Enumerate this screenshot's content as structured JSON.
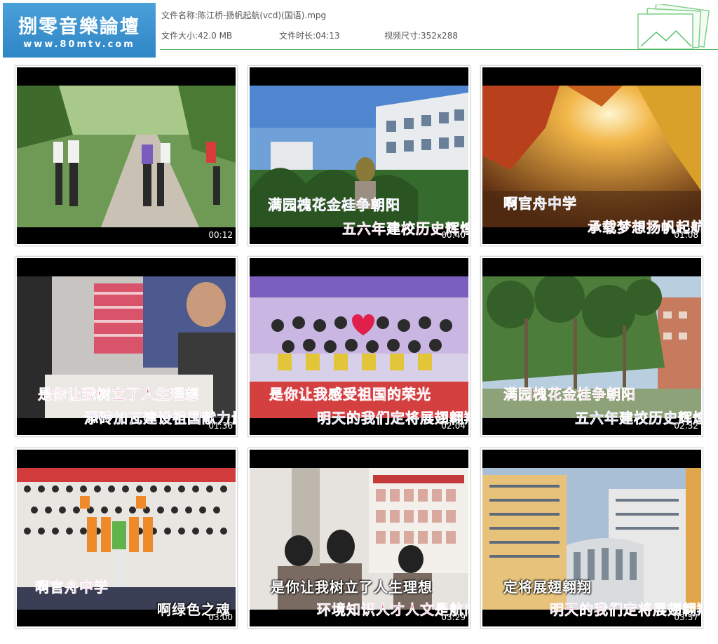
{
  "header": {
    "logo_title": "捌零音樂論壇",
    "logo_url": "www.80mtv.com",
    "file_name_label": "文件名称:",
    "file_name": "陈江桥-扬帆起航(vcd)(国语).mpg",
    "file_size_label": "文件大小:",
    "file_size": "42.0 MB",
    "duration_label": "文件时长:",
    "duration": "04:13",
    "resolution_label": "视频尺寸:",
    "resolution": "352x288"
  },
  "thumbnails": [
    {
      "time": "00:12",
      "lyric1": "",
      "lyric2": ""
    },
    {
      "time": "00:40",
      "lyric1": "满园槐花金桂争朝阳",
      "lyric2": "五六年建校历史辉煌"
    },
    {
      "time": "01:08",
      "lyric1": "啊官舟中学",
      "lyric2": "承载梦想扬帆起航"
    },
    {
      "time": "01:36",
      "lyric1": "是你让我树立了人生理想",
      "lyric2": "添砖加瓦建设祖国献力量"
    },
    {
      "time": "02:04",
      "lyric1": "是你让我感受祖国的荣光",
      "lyric2": "明天的我们定将展翅翱翔"
    },
    {
      "time": "02:32",
      "lyric1": "满园槐花金桂争朝阳",
      "lyric2": "五六年建校历史辉煌"
    },
    {
      "time": "03:00",
      "lyric1": "啊官舟中学",
      "lyric2": "啊绿色之魂"
    },
    {
      "time": "03:29",
      "lyric1": "是你让我树立了人生理想",
      "lyric2": "环境知识人才人文是航向"
    },
    {
      "time": "03:57",
      "lyric1": "定将展翅翱翔",
      "lyric2": "明天的我们定将展翅翱翔"
    }
  ],
  "colors": {
    "logo_bg": "#3a92cf",
    "divider": "#4db35a",
    "lyric_blue": "#2a3ccf",
    "lyric_pink": "#e0107a"
  }
}
